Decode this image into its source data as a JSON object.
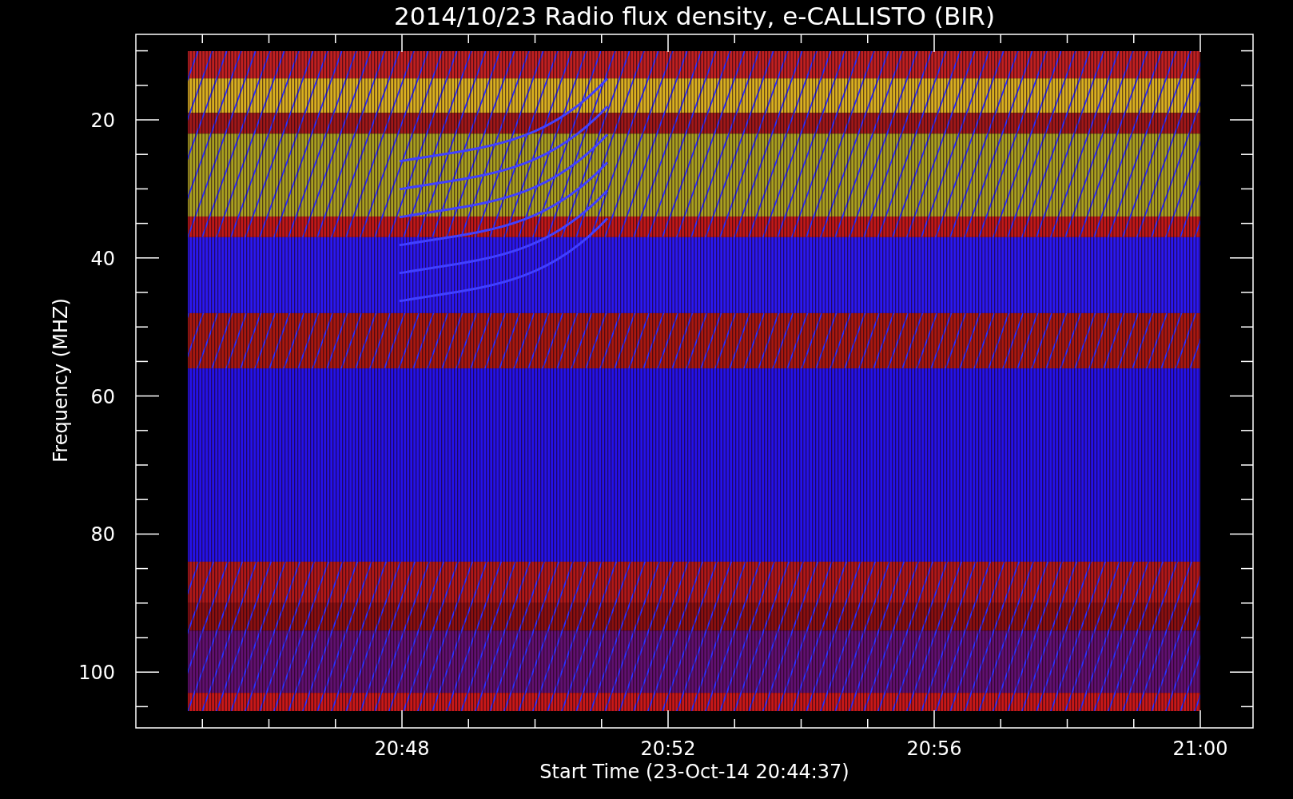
{
  "plot": {
    "title": "2014/10/23  Radio flux density, e-CALLISTO (BIR)",
    "ylabel": "Frequency (MHZ)",
    "yticks": [
      "20",
      "40",
      "60",
      "80",
      "100"
    ],
    "xticks": [
      "20:48",
      "20:52",
      "20:56",
      "21:00"
    ],
    "xlabel": "Start Time (23-Oct-14 20:44:37)"
  }
}
